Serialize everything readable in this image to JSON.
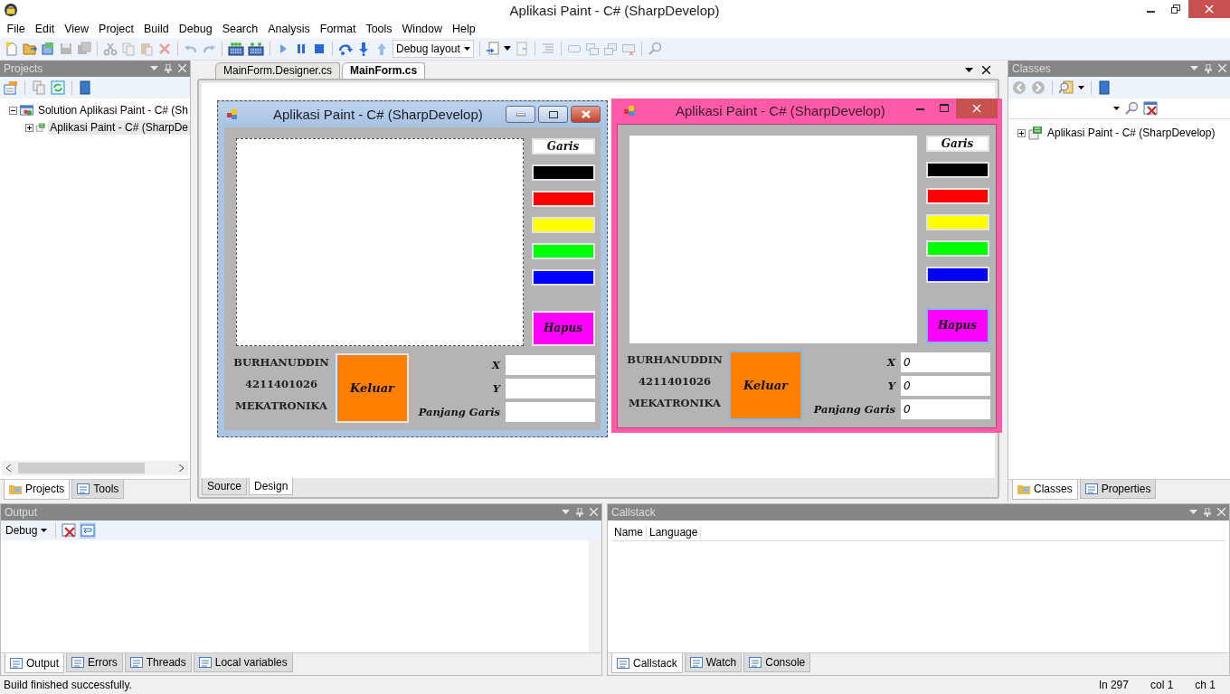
{
  "window": {
    "title": "Aplikasi Paint - C# (SharpDevelop)"
  },
  "menu": [
    "File",
    "Edit",
    "View",
    "Project",
    "Build",
    "Debug",
    "Search",
    "Analysis",
    "Format",
    "Tools",
    "Window",
    "Help"
  ],
  "toolbar": {
    "layout_dropdown": "Debug layout"
  },
  "projects_panel": {
    "title": "Projects",
    "tree": [
      {
        "label": "Solution Aplikasi Paint - C# (Sh",
        "expanded": true,
        "selected": false,
        "children": [
          {
            "label": "Aplikasi Paint - C# (SharpDe",
            "expanded": false,
            "selected": true
          }
        ]
      }
    ],
    "tabs": [
      {
        "label": "Projects",
        "selected": true
      },
      {
        "label": "Tools",
        "selected": false
      }
    ]
  },
  "editor": {
    "tabs": [
      {
        "label": "MainForm.Designer.cs",
        "selected": false
      },
      {
        "label": "MainForm.cs",
        "selected": true
      }
    ],
    "view_tabs": [
      {
        "label": "Source",
        "selected": false
      },
      {
        "label": "Design",
        "selected": true
      }
    ],
    "forms": [
      {
        "kind": "designer",
        "title": "Aplikasi Paint - C# (SharpDevelop)",
        "line_button": "Garis",
        "colors": [
          {
            "color": "#000000"
          },
          {
            "color": "#ff0000"
          },
          {
            "color": "#ffff00"
          },
          {
            "color": "#00ff00"
          },
          {
            "color": "#0000ff"
          }
        ],
        "clear_button": "Hapus",
        "name_lines": [
          "BURHANUDDIN",
          "4211401026",
          "MEKATRONIKA"
        ],
        "exit_button": "Keluar",
        "fields": [
          {
            "label": "X"
          },
          {
            "label": "Y"
          },
          {
            "label": "Panjang Garis"
          }
        ]
      },
      {
        "kind": "running",
        "title": "Aplikasi Paint - C# (SharpDevelop)",
        "line_button": "Garis",
        "colors": [
          {
            "color": "#000000"
          },
          {
            "color": "#ff0000"
          },
          {
            "color": "#ffff00"
          },
          {
            "color": "#00ff00"
          },
          {
            "color": "#0000ff"
          }
        ],
        "clear_button": "Hapus",
        "name_lines": [
          "BURHANUDDIN",
          "4211401026",
          "MEKATRONIKA"
        ],
        "exit_button": "Keluar",
        "fields": [
          {
            "label": "X",
            "value": "0"
          },
          {
            "label": "Y",
            "value": "0"
          },
          {
            "label": "Panjang Garis",
            "value": "0"
          }
        ]
      }
    ]
  },
  "classes_panel": {
    "title": "Classes",
    "tree": [
      {
        "label": "Aplikasi Paint - C# (SharpDevelop)",
        "expanded": false
      }
    ],
    "tabs": [
      {
        "label": "Classes",
        "selected": true
      },
      {
        "label": "Properties",
        "selected": false
      }
    ]
  },
  "output_panel": {
    "title": "Output",
    "category": "Debug",
    "tabs": [
      {
        "label": "Output",
        "selected": true
      },
      {
        "label": "Errors",
        "selected": false
      },
      {
        "label": "Threads",
        "selected": false
      },
      {
        "label": "Local variables",
        "selected": false
      }
    ]
  },
  "callstack_panel": {
    "title": "Callstack",
    "columns": [
      "Name",
      "Language"
    ],
    "tabs": [
      {
        "label": "Callstack",
        "selected": true
      },
      {
        "label": "Watch",
        "selected": false
      },
      {
        "label": "Console",
        "selected": false
      }
    ]
  },
  "status_bar": {
    "message": "Build finished successfully.",
    "line": "ln 297",
    "col": "col 1",
    "ch": "ch 1"
  }
}
